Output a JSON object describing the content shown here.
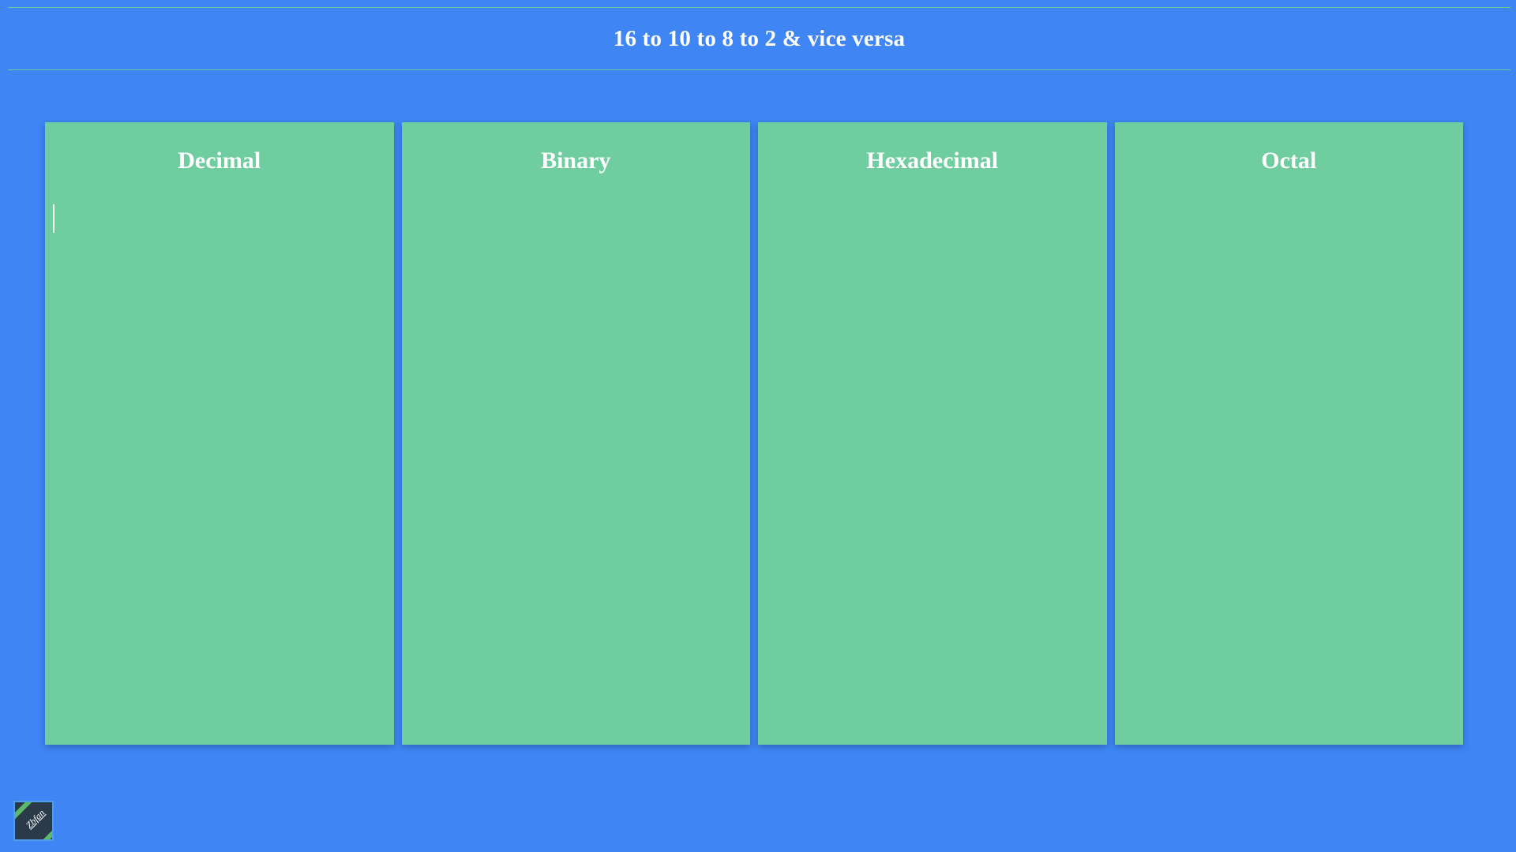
{
  "header": {
    "title": "16 to 10 to 8 to 2 & vice versa"
  },
  "panels": [
    {
      "id": "decimal",
      "label": "Decimal",
      "value": ""
    },
    {
      "id": "binary",
      "label": "Binary",
      "value": ""
    },
    {
      "id": "hexadecimal",
      "label": "Hexadecimal",
      "value": ""
    },
    {
      "id": "octal",
      "label": "Octal",
      "value": ""
    }
  ],
  "logo": {
    "text": "Zbfan"
  },
  "colors": {
    "background": "#3f86f4",
    "panel": "#6fcd9f",
    "text": "#ffffff"
  }
}
